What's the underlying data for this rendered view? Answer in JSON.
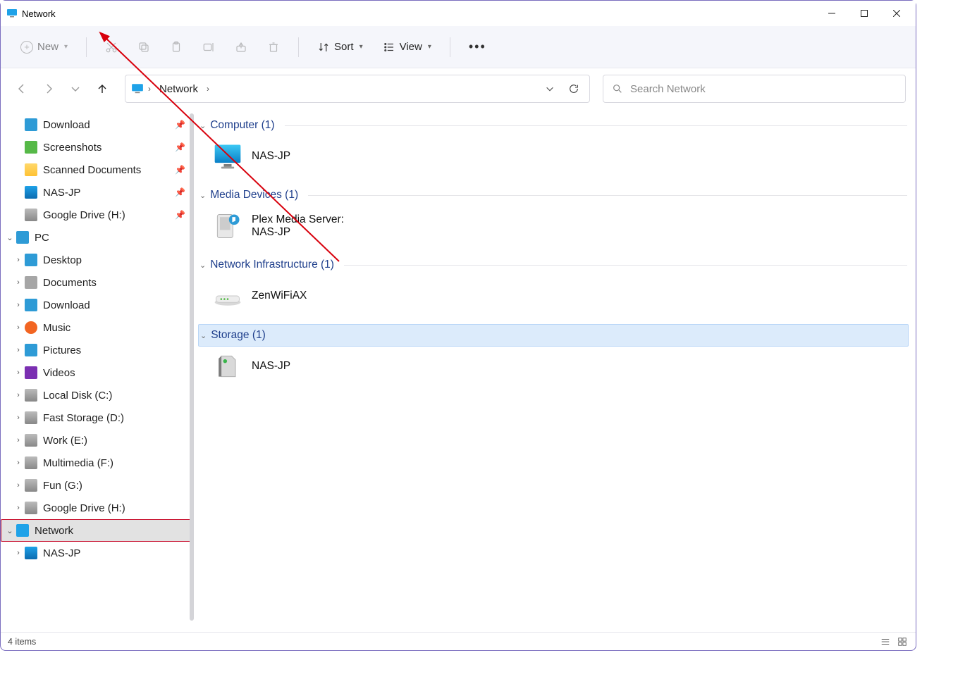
{
  "window": {
    "title": "Network"
  },
  "toolbar": {
    "new_label": "New",
    "sort_label": "Sort",
    "view_label": "View"
  },
  "breadcrumb": {
    "item1": "Network"
  },
  "search": {
    "placeholder": "Search Network"
  },
  "sidebar": {
    "quick": [
      {
        "label": "Download",
        "icon": "download-icon",
        "pin": true
      },
      {
        "label": "Screenshots",
        "icon": "folder-green-icon",
        "pin": true
      },
      {
        "label": "Scanned Documents",
        "icon": "folder-icon",
        "pin": true
      },
      {
        "label": "NAS-JP",
        "icon": "monitor-icon",
        "pin": true
      },
      {
        "label": "Google Drive (H:)",
        "icon": "drive-icon",
        "pin": true
      }
    ],
    "pc_label": "PC",
    "pc_children": [
      {
        "label": "Desktop",
        "icon": "desktop-icon"
      },
      {
        "label": "Documents",
        "icon": "documents-icon"
      },
      {
        "label": "Download",
        "icon": "download-icon"
      },
      {
        "label": "Music",
        "icon": "music-icon"
      },
      {
        "label": "Pictures",
        "icon": "pictures-icon"
      },
      {
        "label": "Videos",
        "icon": "videos-icon"
      },
      {
        "label": "Local Disk (C:)",
        "icon": "drive-icon"
      },
      {
        "label": "Fast Storage (D:)",
        "icon": "drive-icon"
      },
      {
        "label": "Work (E:)",
        "icon": "drive-icon"
      },
      {
        "label": "Multimedia (F:)",
        "icon": "drive-icon"
      },
      {
        "label": "Fun (G:)",
        "icon": "drive-icon"
      },
      {
        "label": "Google Drive (H:)",
        "icon": "drive-icon"
      }
    ],
    "network_label": "Network",
    "network_children": [
      {
        "label": "NAS-JP",
        "icon": "monitor-icon"
      }
    ]
  },
  "groups": {
    "computer": {
      "header": "Computer (1)",
      "item": "NAS-JP"
    },
    "media": {
      "header": "Media Devices (1)",
      "item": "Plex Media Server:\nNAS-JP"
    },
    "infra": {
      "header": "Network Infrastructure (1)",
      "item": "ZenWiFiAX"
    },
    "storage": {
      "header": "Storage (1)",
      "item": "NAS-JP"
    }
  },
  "status": {
    "text": "4 items"
  }
}
